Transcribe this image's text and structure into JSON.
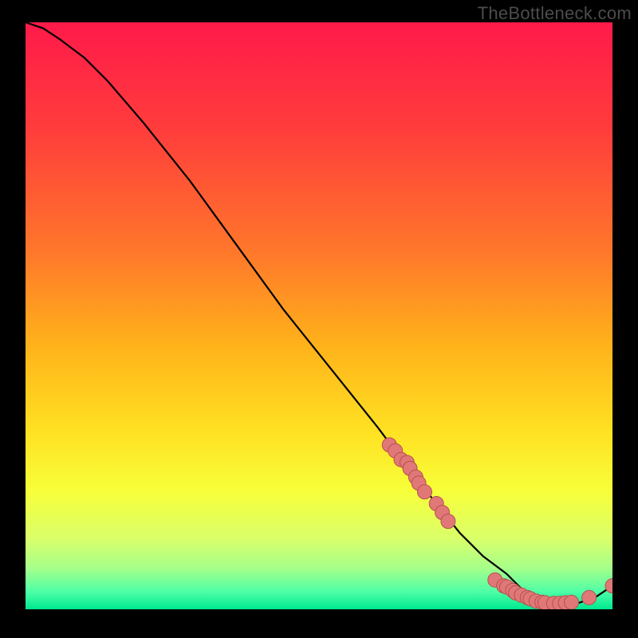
{
  "watermark": "TheBottleneck.com",
  "chart_data": {
    "type": "line",
    "title": "",
    "xlabel": "",
    "ylabel": "",
    "xlim": [
      0,
      100
    ],
    "ylim": [
      0,
      100
    ],
    "grid": false,
    "legend": false,
    "background_gradient": {
      "stops": [
        {
          "pos": 0.0,
          "color": "#ff1a4a"
        },
        {
          "pos": 0.18,
          "color": "#ff3c3c"
        },
        {
          "pos": 0.4,
          "color": "#ff7a2a"
        },
        {
          "pos": 0.55,
          "color": "#ffb21a"
        },
        {
          "pos": 0.7,
          "color": "#ffe223"
        },
        {
          "pos": 0.8,
          "color": "#f7ff3a"
        },
        {
          "pos": 0.88,
          "color": "#d9ff6a"
        },
        {
          "pos": 0.93,
          "color": "#a6ff8a"
        },
        {
          "pos": 0.97,
          "color": "#4dffa6"
        },
        {
          "pos": 1.0,
          "color": "#00e890"
        }
      ]
    },
    "series": [
      {
        "name": "curve",
        "type": "line",
        "x": [
          0,
          3,
          6,
          10,
          14,
          20,
          28,
          36,
          44,
          52,
          60,
          66,
          70,
          74,
          78,
          82,
          85,
          88,
          91,
          94,
          97,
          100
        ],
        "y": [
          100,
          99,
          97,
          94,
          90,
          83,
          73,
          62,
          51,
          41,
          31,
          23,
          18,
          13,
          9,
          6,
          3,
          2,
          1,
          1,
          2,
          4
        ]
      },
      {
        "name": "markers-descent",
        "type": "scatter",
        "x": [
          62,
          63,
          64,
          65,
          65.5,
          66.5,
          67,
          68,
          70,
          71,
          72
        ],
        "y": [
          28,
          27,
          25.5,
          25,
          24,
          22.5,
          21.5,
          20,
          18,
          16.5,
          15
        ]
      },
      {
        "name": "markers-trough",
        "type": "scatter",
        "x": [
          80,
          81.5,
          82,
          83,
          83.5,
          84.5,
          85.5,
          86,
          87,
          88,
          88.5,
          90,
          91,
          92,
          93,
          96,
          100
        ],
        "y": [
          5,
          4,
          3.8,
          3.2,
          2.8,
          2.4,
          2.0,
          1.8,
          1.4,
          1.2,
          1.1,
          1.0,
          1.0,
          1.1,
          1.2,
          2.0,
          4
        ]
      }
    ],
    "marker_style": {
      "fill": "#e07878",
      "stroke": "#b84f4f",
      "r": 9
    }
  }
}
